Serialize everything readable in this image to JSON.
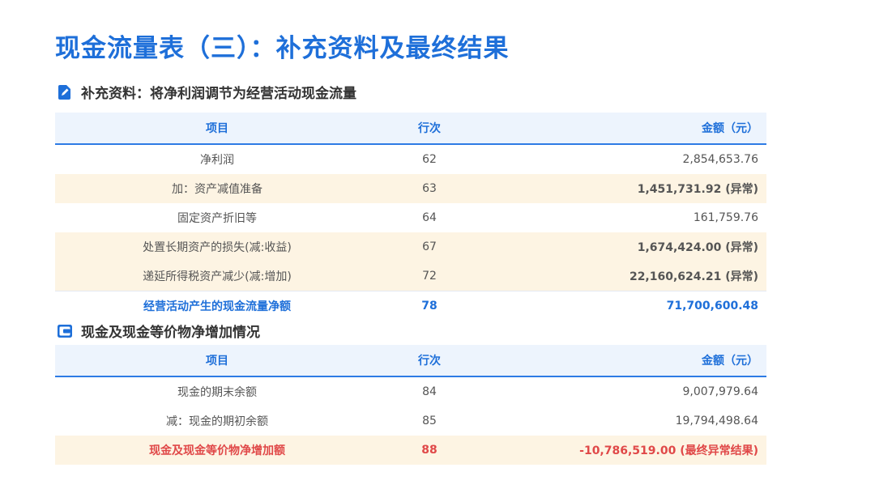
{
  "title": "现金流量表（三）：补充资料及最终结果",
  "section1": {
    "heading": "补充资料：将净利润调节为经营活动现金流量",
    "icon": "edit-document-icon",
    "headers": [
      "项目",
      "行次",
      "金额（元）"
    ],
    "rows": [
      {
        "item": "净利润",
        "line": "62",
        "amount": "2,854,653.76",
        "flag": ""
      },
      {
        "item": "加：资产减值准备",
        "line": "63",
        "amount": "1,451,731.92 (异常)",
        "flag": "abnormal"
      },
      {
        "item": "固定资产折旧等",
        "line": "64",
        "amount": "161,759.76",
        "flag": ""
      },
      {
        "item": "处置长期资产的损失(减:收益)",
        "line": "67",
        "amount": "1,674,424.00 (异常)",
        "flag": "abnormal"
      },
      {
        "item": "递延所得税资产减少(减:增加)",
        "line": "72",
        "amount": "22,160,624.21 (异常)",
        "flag": "abnormal"
      }
    ],
    "total": {
      "item": "经营活动产生的现金流量净额",
      "line": "78",
      "amount": "71,700,600.48"
    }
  },
  "section2": {
    "heading": "现金及现金等价物净增加情况",
    "icon": "wallet-icon",
    "headers": [
      "项目",
      "行次",
      "金额（元）"
    ],
    "rows": [
      {
        "item": "现金的期末余额",
        "line": "84",
        "amount": "9,007,979.64"
      },
      {
        "item": "减：现金的期初余额",
        "line": "85",
        "amount": "19,794,498.64"
      }
    ],
    "final": {
      "item": "现金及现金等价物净增加额",
      "line": "88",
      "amount": "-10,786,519.00 (最终异常结果)"
    }
  },
  "colors": {
    "accent": "#1e6fd9",
    "alert": "#e04848",
    "highlight_row": "#fdf4e3",
    "header_bg": "#edf4fd"
  }
}
